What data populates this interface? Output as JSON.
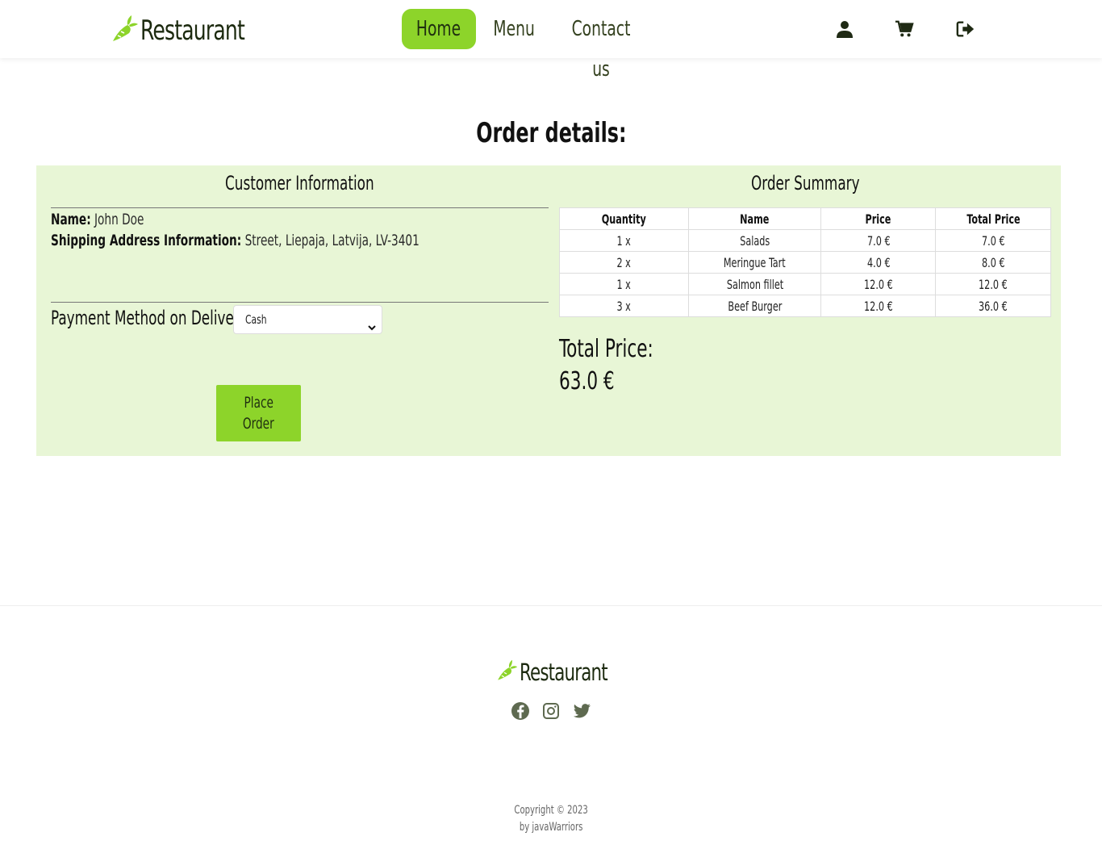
{
  "brand": {
    "name": "Restaurant",
    "logo_icon": "carrot-icon",
    "accent_color": "#8dd42a"
  },
  "nav": {
    "home": "Home",
    "menu": "Menu",
    "contact": "Contact us"
  },
  "header_icons": [
    "user-icon",
    "cart-icon",
    "logout-icon"
  ],
  "page_title": "Order details:",
  "customer": {
    "title": "Customer Information",
    "name_label": "Name:",
    "name_value": "John Doe",
    "address_label": "Shipping Address Information:",
    "address_value": "Street, Liepaja, Latvija, LV-3401",
    "payment_label": "Payment Method on Delivery:",
    "payment_selected": "Cash",
    "place_order_line1": "Place",
    "place_order_line2": "Order"
  },
  "summary": {
    "title": "Order Summary",
    "headers": [
      "Quantity",
      "Name",
      "Price",
      "Total Price"
    ],
    "rows": [
      [
        "1 x",
        "Salads",
        "7.0 €",
        "7.0 €"
      ],
      [
        "2 x",
        "Meringue Tart",
        "4.0 €",
        "8.0 €"
      ],
      [
        "1 x",
        "Salmon fillet",
        "12.0 €",
        "12.0 €"
      ],
      [
        "3 x",
        "Beef Burger",
        "12.0 €",
        "36.0 €"
      ]
    ],
    "total_label": "Total Price:",
    "total_value": "63.0 €"
  },
  "footer": {
    "brand": "Restaurant",
    "social": [
      "facebook-icon",
      "instagram-icon",
      "twitter-icon"
    ],
    "copyright": "Copyright © 2023",
    "by": "by javaWarriors"
  }
}
